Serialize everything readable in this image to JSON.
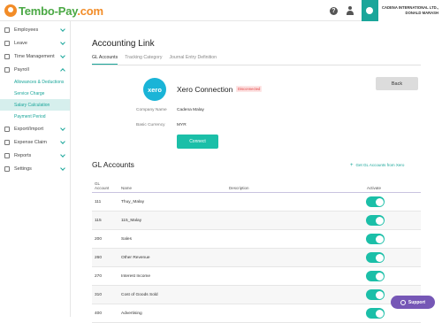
{
  "app": {
    "logo_main": "Tembo-Pay",
    "logo_dot": ".com"
  },
  "header": {
    "help_icon": "question-icon",
    "user_icon": "user-icon",
    "company_name": "CADENA INTERNATIONAL LTD.,",
    "user_name": "DONALD MARASH"
  },
  "sidebar": {
    "items": [
      {
        "label": "Employees",
        "icon": "employees-icon",
        "expanded": false
      },
      {
        "label": "Leave",
        "icon": "leave-icon",
        "expanded": false
      },
      {
        "label": "Time Management",
        "icon": "clock-icon",
        "expanded": false
      },
      {
        "label": "Payroll",
        "icon": "payroll-icon",
        "expanded": true
      },
      {
        "label": "Export/Import",
        "icon": "export-icon",
        "expanded": false
      },
      {
        "label": "Expense Claim",
        "icon": "expense-icon",
        "expanded": false
      },
      {
        "label": "Reports",
        "icon": "reports-icon",
        "expanded": false
      },
      {
        "label": "Settings",
        "icon": "settings-icon",
        "expanded": false
      }
    ],
    "payroll_sub": [
      {
        "label": "Allowances & Deductions"
      },
      {
        "label": "Service Charge"
      },
      {
        "label": "Salary Calculation",
        "active": true
      },
      {
        "label": "Payment Period"
      }
    ]
  },
  "main": {
    "title": "Accounting Link",
    "tabs": [
      {
        "label": "GL Accounts",
        "active": true
      },
      {
        "label": "Tracking Category"
      },
      {
        "label": "Journal Entry Definition"
      }
    ],
    "xero": {
      "logo_text": "xero",
      "title": "Xero Connection",
      "status": "Disconnected",
      "back_label": "Back",
      "company_label": "Company Name",
      "company_value": "Cadena Malay",
      "currency_label": "Basic Currency",
      "currency_value": "MYR",
      "connect_label": "Connect"
    },
    "gl": {
      "title": "GL Accounts",
      "get_link": "Get GL Accounts from Xero",
      "columns": {
        "account_line1": "GL",
        "account_line2": "Account",
        "name": "Name",
        "description": "Description",
        "activate": "Activate"
      },
      "rows": [
        {
          "account": "111",
          "name": "Thuy_Malay",
          "description": "",
          "active": true
        },
        {
          "account": "115",
          "name": "115_Malay",
          "description": "",
          "active": true
        },
        {
          "account": "200",
          "name": "Sales",
          "description": "",
          "active": true
        },
        {
          "account": "260",
          "name": "Other Revenue",
          "description": "",
          "active": true
        },
        {
          "account": "270",
          "name": "Interest Income",
          "description": "",
          "active": true
        },
        {
          "account": "310",
          "name": "Cost of Goods Sold",
          "description": "",
          "active": true
        },
        {
          "account": "400",
          "name": "Advertising",
          "description": "",
          "active": true
        }
      ]
    }
  },
  "support": {
    "label": "Support"
  },
  "colors": {
    "accent": "#1aa69a",
    "brand_green": "#4aa844",
    "brand_orange": "#f28c28",
    "toggle": "#1bbfa8",
    "support": "#7657b6",
    "danger": "#e23b3b"
  }
}
